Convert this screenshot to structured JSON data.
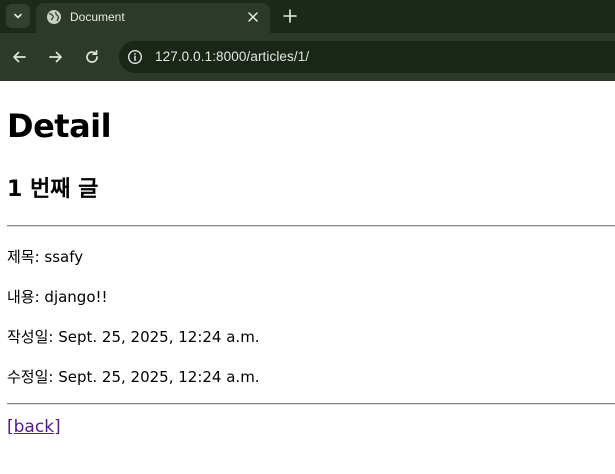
{
  "browser": {
    "tab": {
      "title": "Document",
      "favicon": "globe-icon"
    },
    "address_bar": {
      "url": "127.0.0.1:8000/articles/1/"
    },
    "colors": {
      "tabstrip_bg": "#1c2a1a",
      "toolbar_bg": "#2d3a2a",
      "omnibox_bg": "#1a2618"
    }
  },
  "page": {
    "heading": "Detail",
    "subheading": "1 번째 글",
    "fields": [
      {
        "label": "제목",
        "text": "제목: ssafy"
      },
      {
        "label": "내용",
        "text": "내용: django!!"
      },
      {
        "label": "작성일",
        "text": "작성일: Sept. 25, 2025, 12:24 a.m."
      },
      {
        "label": "수정일",
        "text": "수정일: Sept. 25, 2025, 12:24 a.m."
      }
    ],
    "back_link": {
      "open": "[",
      "label": "back",
      "close": "]",
      "color": "#551a8b"
    }
  }
}
